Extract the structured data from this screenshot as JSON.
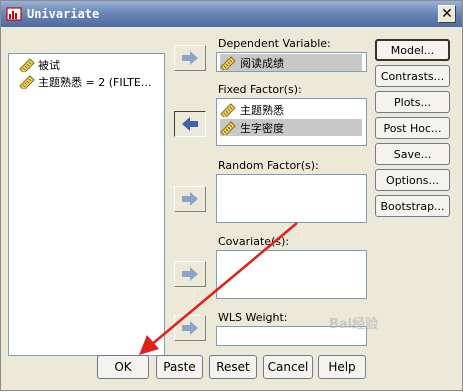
{
  "window": {
    "title": "Univariate",
    "close_glyph": "✕"
  },
  "source_list": {
    "items": [
      {
        "label": "被试",
        "icon": "scale-ruler-icon"
      },
      {
        "label": "主题熟悉 = 2 (FILTE...",
        "icon": "scale-ruler-icon"
      }
    ]
  },
  "dependent": {
    "label": "Dependent Variable:",
    "value": "阅读成绩",
    "icon": "scale-ruler-icon"
  },
  "fixed": {
    "label": "Fixed Factor(s):",
    "items": [
      {
        "label": "主题熟悉",
        "selected": false
      },
      {
        "label": "生字密度",
        "selected": true
      }
    ]
  },
  "random": {
    "label": "Random Factor(s):"
  },
  "covariate": {
    "label": "Covariate(s):"
  },
  "wls": {
    "label": "WLS Weight:"
  },
  "side_buttons": [
    "Model...",
    "Contrasts...",
    "Plots...",
    "Post Hoc...",
    "Save...",
    "Options...",
    "Bootstrap..."
  ],
  "bottom_buttons": [
    "OK",
    "Paste",
    "Reset",
    "Cancel",
    "Help"
  ],
  "watermark": "Bai经验",
  "colors": {
    "title_bar": "#6b87b8",
    "dialog_bg": "#ece9d8",
    "selection": "#c8c8c8",
    "annotation_arrow": "#e0211a",
    "arrow_blue": "#4a6fb0"
  }
}
